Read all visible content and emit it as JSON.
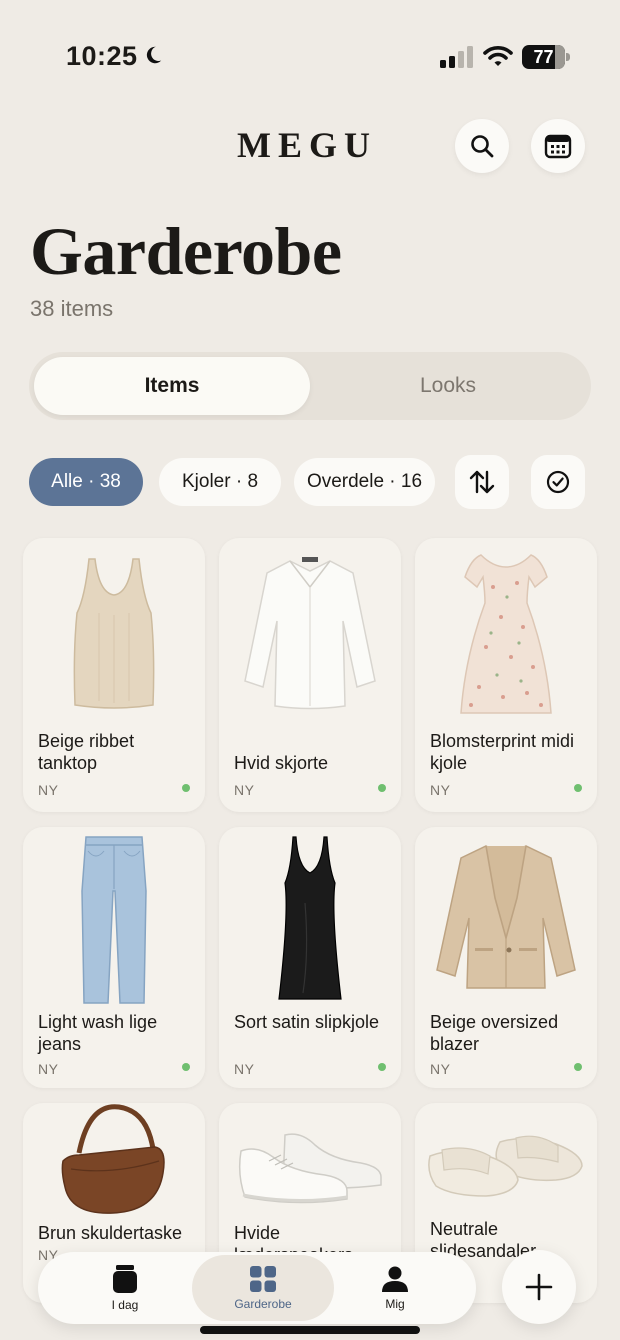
{
  "status_bar": {
    "time": "10:25",
    "battery": "77",
    "battery_level_percent": 77
  },
  "header": {
    "brand": "MEGU",
    "search_icon": "search-icon",
    "calendar_icon": "calendar-icon"
  },
  "page": {
    "title": "Garderobe",
    "item_count": "38 items"
  },
  "segments": {
    "items": "Items",
    "looks": "Looks",
    "selected": "Items"
  },
  "filters": {
    "all": "Alle · 38",
    "dresses": "Kjoler · 8",
    "tops": "Overdele · 16",
    "sort_icon": "sort-arrows-icon",
    "select_icon": "check-circle-icon",
    "active_color": "#5c7496"
  },
  "items": [
    {
      "name": "Beige ribbet tanktop",
      "tag": "NY",
      "icon": "tank-top"
    },
    {
      "name": "Hvid skjorte",
      "tag": "NY",
      "icon": "shirt"
    },
    {
      "name": "Blomsterprint midi kjole",
      "tag": "NY",
      "icon": "floral-dress"
    },
    {
      "name": "Light wash lige jeans",
      "tag": "NY",
      "icon": "jeans"
    },
    {
      "name": "Sort satin slipkjole",
      "tag": "NY",
      "icon": "slip-dress"
    },
    {
      "name": "Beige oversized blazer",
      "tag": "NY",
      "icon": "blazer"
    },
    {
      "name": "Brun skuldertaske",
      "tag": "NY",
      "icon": "shoulder-bag"
    },
    {
      "name": "Hvide lædersneakers",
      "tag": "",
      "icon": "sneakers"
    },
    {
      "name": "Neutrale slidesandaler",
      "tag": "",
      "icon": "slides"
    }
  ],
  "bottom_nav": {
    "today": "I dag",
    "wardrobe": "Garderobe",
    "me": "Mig",
    "active": "Garderobe",
    "active_color": "#4e6688"
  },
  "colors": {
    "background": "#efebe5",
    "card": "#f5f2ec",
    "new_dot": "#6fbf6f"
  }
}
